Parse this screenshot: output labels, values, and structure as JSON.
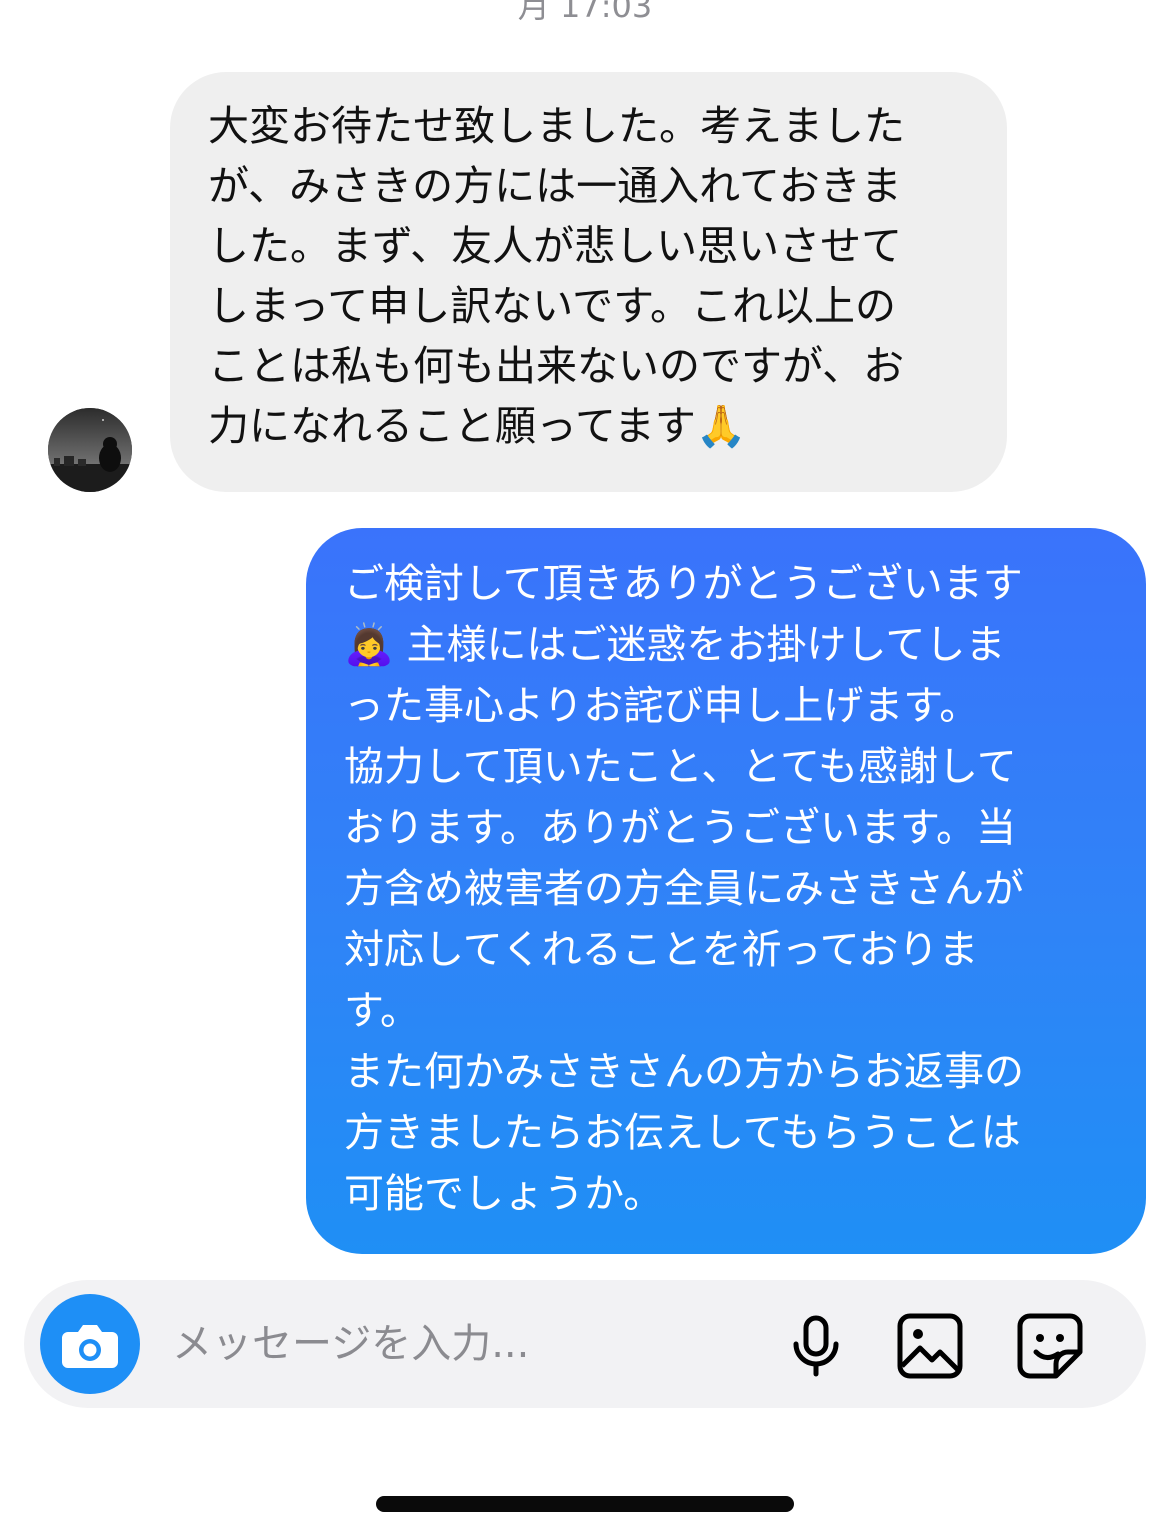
{
  "thread": {
    "timestamp": "月 17:03"
  },
  "messages": [
    {
      "direction": "incoming",
      "text": "大変お待たせ致しました。考えました\nが、みさきの方には一通入れておきま\nした。まず、友人が悲しい思いさせて\nしまって申し訳ないです。これ以上の\nことは私も何も出来ないのですが、お\n力になれること願ってます🙏"
    },
    {
      "direction": "outgoing",
      "text": "ご検討して頂きありがとうございます\n🙇‍♀️ 主様にはご迷惑をお掛けしてしま\nった事心よりお詫び申し上げます。\n協力して頂いたこと、とても感謝して\nおります。ありがとうございます。当\n方含め被害者の方全員にみさきさんが\n対応してくれることを祈っておりま\nす。\nまた何かみさきさんの方からお返事の\n方きましたらお伝えしてもらうことは\n可能でしょうか。"
    }
  ],
  "composer": {
    "placeholder": "メッセージを入力...",
    "icons": [
      "camera-icon",
      "microphone-icon",
      "gallery-icon",
      "sticker-icon"
    ]
  },
  "colors": {
    "incoming_bubble": "#efefef",
    "outgoing_bubble_top": "#3a73fb",
    "outgoing_bubble_bottom": "#1f8ff5",
    "camera_button": "#1e8ff6",
    "timestamp": "#8e8e93"
  }
}
